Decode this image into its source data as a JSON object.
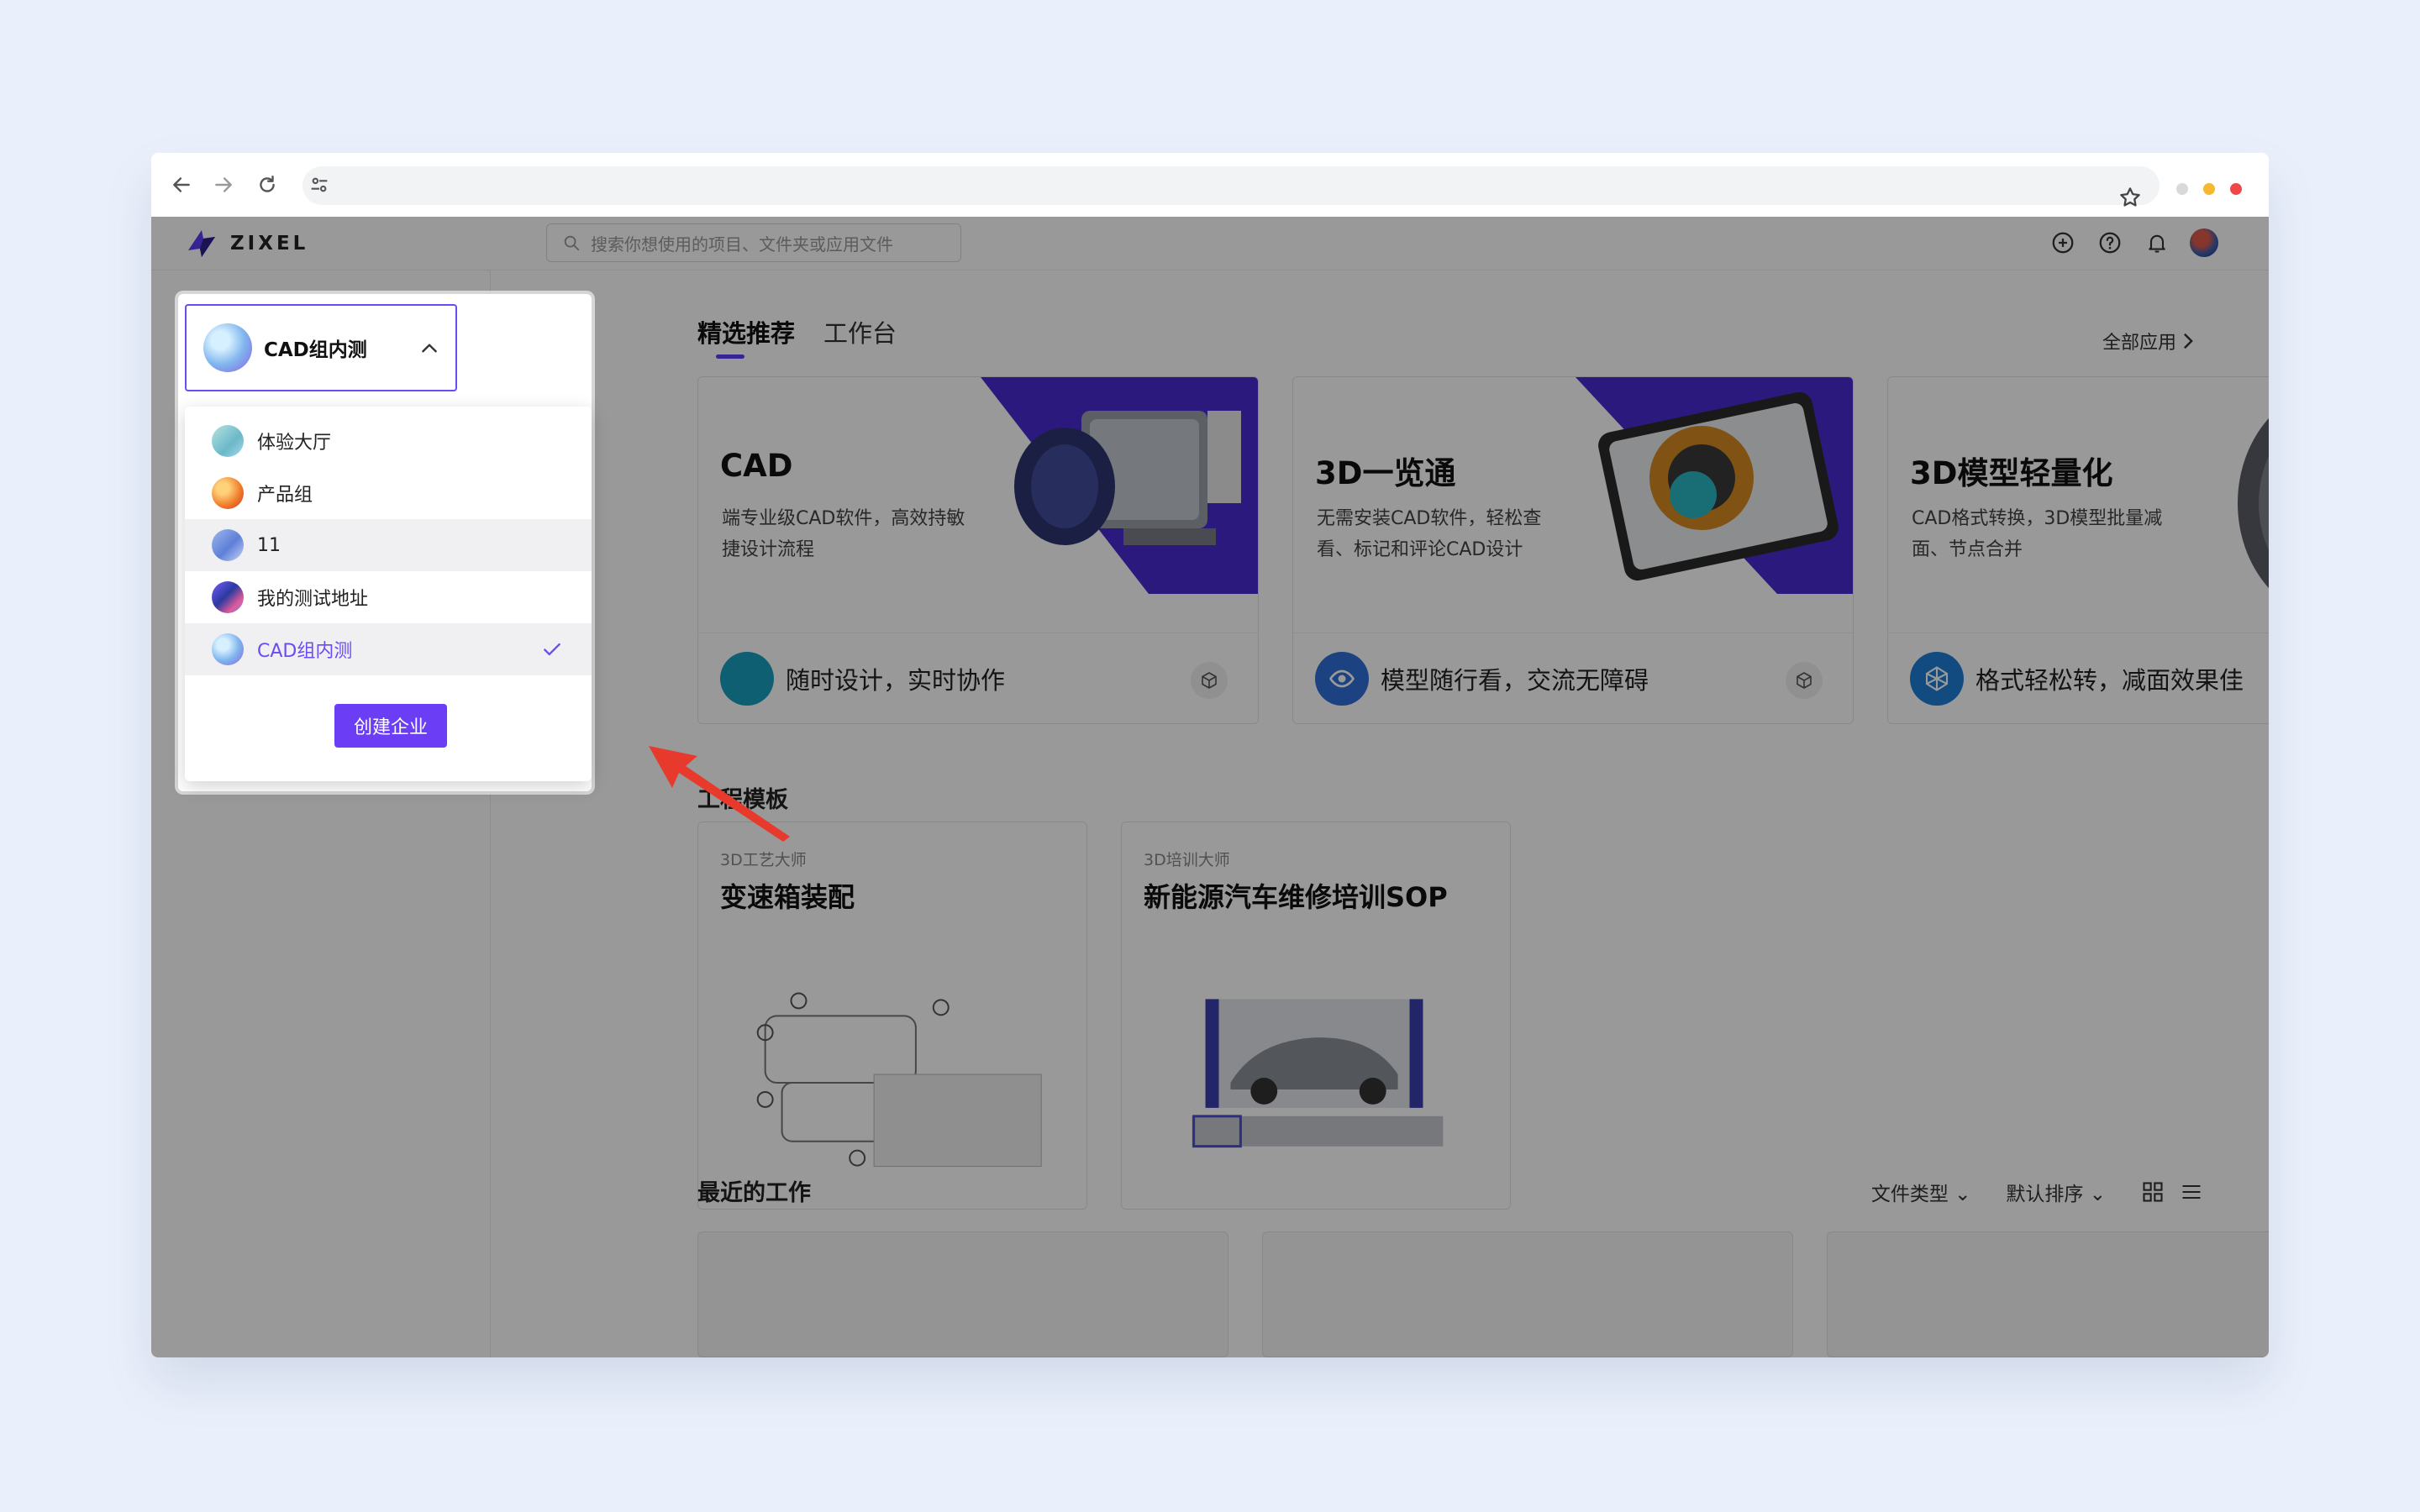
{
  "browser": {
    "nav": {
      "back_icon": "arrow-left-icon",
      "forward_icon": "arrow-right-icon",
      "reload_icon": "reload-icon"
    },
    "address": {
      "value": ""
    },
    "window_dots": [
      "#d9d9d9",
      "#f5b82e",
      "#f04848"
    ]
  },
  "topbar": {
    "logo_text": "ZIXEL",
    "search_placeholder": "搜索你想使用的项目、文件夹或应用文件"
  },
  "tabs": [
    {
      "label": "精选推荐",
      "active": true
    },
    {
      "label": "工作台",
      "active": false
    }
  ],
  "all_apps_label": "全部应用",
  "feature_cards": [
    {
      "title": "CAD",
      "desc": "端专业级CAD软件，高效持敏捷设计流程",
      "foot": "随时设计，实时协作"
    },
    {
      "title": "3D一览通",
      "desc": "无需安装CAD软件，轻松查看、标记和评论CAD设计",
      "foot": "模型随行看，交流无障碍"
    },
    {
      "title": "3D模型轻量化",
      "desc": "CAD格式转换，3D模型批量减面、节点合并",
      "foot": "格式轻松转，减面效果佳"
    }
  ],
  "templates_title": "工程模板",
  "templates": [
    {
      "category": "3D工艺大师",
      "title": "变速箱装配"
    },
    {
      "category": "3D培训大师",
      "title": "新能源汽车维修培训SOP"
    }
  ],
  "recent": {
    "title": "最近的工作",
    "filter_label": "文件类型",
    "sort_label": "默认排序"
  },
  "org_switcher": {
    "current": "CAD组内测",
    "items": [
      {
        "label": "体验大厅",
        "state": "normal"
      },
      {
        "label": "产品组",
        "state": "normal"
      },
      {
        "label": "11",
        "state": "hover"
      },
      {
        "label": "我的测试地址",
        "state": "normal"
      },
      {
        "label": "CAD组内测",
        "state": "selected"
      }
    ],
    "create_label": "创建企业"
  },
  "colors": {
    "accent": "#6b3df5",
    "overlay": "rgba(0,0,0,0.40)",
    "arrow": "#e8392d"
  }
}
